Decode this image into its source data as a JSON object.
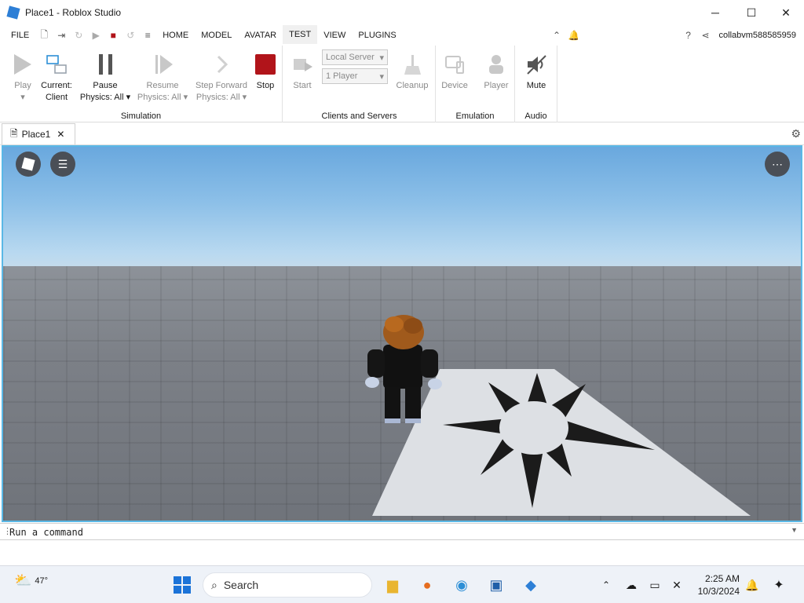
{
  "window": {
    "title": "Place1 - Roblox Studio",
    "minimize": "─",
    "maximize": "☐",
    "close": "✕"
  },
  "menu": {
    "file": "FILE",
    "tabs": [
      {
        "label": "HOME"
      },
      {
        "label": "MODEL"
      },
      {
        "label": "AVATAR"
      },
      {
        "label": "TEST"
      },
      {
        "label": "VIEW"
      },
      {
        "label": "PLUGINS"
      }
    ],
    "username": "collabvm588585959"
  },
  "ribbon": {
    "simulation": {
      "label": "Simulation",
      "play": {
        "line1": "Play",
        "line2": "▾"
      },
      "current": {
        "line1": "Current:",
        "line2": "Client"
      },
      "pause": {
        "line1": "Pause",
        "line2": "Physics: All ▾"
      },
      "resume": {
        "line1": "Resume",
        "line2": "Physics: All ▾"
      },
      "step": {
        "line1": "Step Forward",
        "line2": "Physics: All ▾"
      },
      "stop": {
        "line1": "Stop"
      }
    },
    "clients": {
      "label": "Clients and Servers",
      "start": "Start",
      "server_select": "Local Server",
      "players_select": "1 Player",
      "cleanup": "Cleanup"
    },
    "emulation": {
      "label": "Emulation",
      "device": "Device",
      "player": "Player"
    },
    "audio": {
      "label": "Audio",
      "mute": "Mute"
    }
  },
  "doc_tab": {
    "label": "Place1",
    "close": "✕"
  },
  "command": {
    "placeholder": "Run a command",
    "grip": "⋮",
    "chevron": "▼"
  },
  "taskbar": {
    "weather": "47°",
    "search": "Search",
    "time": "2:25 AM",
    "date": "10/3/2024"
  },
  "colors": {
    "accent": "#5ab8e6",
    "stop": "#b1141a"
  },
  "icons": [
    "roblox-logo-icon",
    "chat-icon",
    "more-options-icon",
    "settings-gear-icon"
  ]
}
